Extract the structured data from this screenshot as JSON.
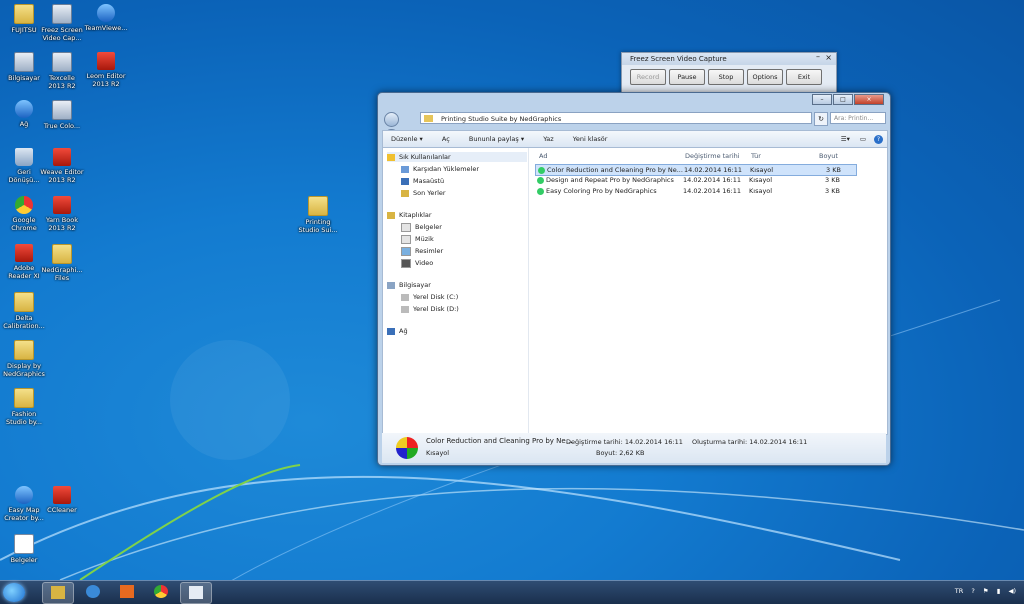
{
  "desktop": {
    "icons": [
      {
        "label": "FUJITSU",
        "kind": "folder"
      },
      {
        "label": "Freez Screen Video Cap...",
        "kind": "app"
      },
      {
        "label": "TeamViewe...",
        "kind": "blue"
      },
      {
        "label": "Bilgisayar",
        "kind": "app"
      },
      {
        "label": "Texcelle 2013 R2",
        "kind": "app"
      },
      {
        "label": "Leom Editor 2013 R2",
        "kind": "red"
      },
      {
        "label": "Ağ",
        "kind": "blue"
      },
      {
        "label": "True Colo...",
        "kind": "app"
      },
      {
        "label": "Geri Dönüşü...",
        "kind": "bin"
      },
      {
        "label": "Weave Editor 2013 R2",
        "kind": "red"
      },
      {
        "label": "Google Chrome",
        "kind": "chrome"
      },
      {
        "label": "Yarn Book 2013 R2",
        "kind": "red"
      },
      {
        "label": "Adobe Reader XI",
        "kind": "red"
      },
      {
        "label": "NedGraphi... Files",
        "kind": "folder"
      },
      {
        "label": "Delta Calibration...",
        "kind": "folder"
      },
      {
        "label": "Display by NedGraphics",
        "kind": "folder"
      },
      {
        "label": "Fashion Studio by...",
        "kind": "folder"
      },
      {
        "label": "Easy Map Creator by...",
        "kind": "blue"
      },
      {
        "label": "CCleaner",
        "kind": "red"
      },
      {
        "label": "Belgeler",
        "kind": "doc"
      },
      {
        "label": "Printing Studio Sui...",
        "kind": "folder"
      }
    ]
  },
  "freez": {
    "title": "Freez Screen Video Capture",
    "buttons": {
      "record": "Record",
      "pause": "Pause",
      "stop": "Stop",
      "options": "Options",
      "exit": "Exit"
    }
  },
  "explorer": {
    "address": "Printing Studio Suite by NedGraphics",
    "search_placeholder": "Ara: Printin...",
    "toolbar": {
      "organize": "Düzenle ▾",
      "open": "Aç",
      "share": "Bununla paylaş ▾",
      "burn": "Yaz",
      "new_folder": "Yeni klasör"
    },
    "nav": {
      "favorites": "Sık Kullanılanlar",
      "downloads": "Karşıdan Yüklemeler",
      "desktop": "Masaüstü",
      "recent": "Son Yerler",
      "libraries": "Kitaplıklar",
      "documents": "Belgeler",
      "music": "Müzik",
      "pictures": "Resimler",
      "videos": "Video",
      "computer": "Bilgisayar",
      "drive_c": "Yerel Disk (C:)",
      "drive_d": "Yerel Disk (D:)",
      "network": "Ağ"
    },
    "columns": {
      "name": "Ad",
      "date": "Değiştirme tarihi",
      "type": "Tür",
      "size": "Boyut"
    },
    "files": [
      {
        "name": "Color Reduction and Cleaning Pro by Ne...",
        "date": "14.02.2014 16:11",
        "type": "Kısayol",
        "size": "3 KB"
      },
      {
        "name": "Design and Repeat Pro by NedGraphics",
        "date": "14.02.2014 16:11",
        "type": "Kısayol",
        "size": "3 KB"
      },
      {
        "name": "Easy Coloring Pro by NedGraphics",
        "date": "14.02.2014 16:11",
        "type": "Kısayol",
        "size": "3 KB"
      }
    ],
    "details": {
      "name": "Color Reduction and Cleaning Pro by Ne...",
      "modified_label": "Değiştirme tarihi: 14.02.2014 16:11",
      "created_label": "Oluşturma tarihi: 14.02.2014 16:11",
      "type": "Kısayol",
      "size_label": "Boyut: 2,62 KB"
    }
  },
  "taskbar": {
    "lang": "TR"
  }
}
